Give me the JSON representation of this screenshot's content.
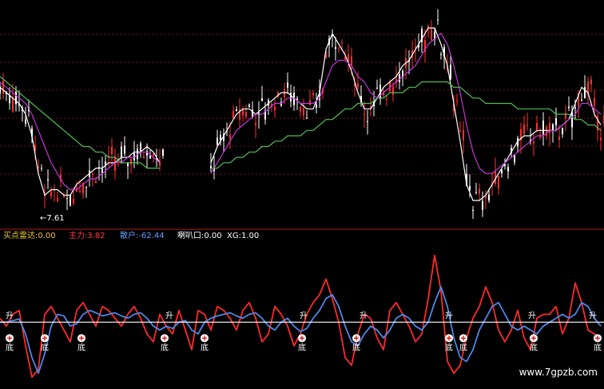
{
  "colors": {
    "background": "#000000",
    "grid": "#7a1414",
    "divider": "#b01818",
    "zero_line": "#ffffff",
    "red_line": "#ff2a2a",
    "blue_line": "#4f86e6",
    "ma_white": "#ffffff",
    "ma_magenta": "#c238d8",
    "ma_green": "#4fbf4f",
    "candle_up": "#ff3030",
    "candle_down": "#ffffff",
    "label_orange": "#e8c33a",
    "label_red": "#ff3c3c",
    "label_blue": "#5fa0ff",
    "label_white": "#ffffff",
    "marker_fill": "#ffffff",
    "marker_cross": "#e01e1e",
    "arrow_yellow": "#f0c040",
    "watermark": "#ffffff"
  },
  "chart_data": [
    {
      "type": "line",
      "panel": "price",
      "low_label": "←7.61",
      "x": [
        0,
        8,
        16,
        24,
        32,
        40,
        48,
        56,
        64,
        72,
        80,
        88,
        96,
        104,
        112,
        120,
        128,
        136,
        144,
        152,
        160,
        168,
        176,
        184,
        192,
        200,
        208,
        216,
        224,
        232,
        240,
        248,
        256,
        264,
        272,
        280,
        288,
        296,
        304,
        312,
        320,
        328,
        336,
        344,
        352,
        360,
        368,
        376,
        384,
        392,
        400,
        408,
        416,
        424,
        432,
        440,
        448,
        456,
        464,
        472,
        480,
        488,
        496,
        504,
        512,
        520,
        528,
        536,
        544,
        552,
        560,
        568,
        576,
        584,
        592,
        600,
        608,
        616,
        624,
        632,
        640,
        648,
        656,
        664,
        672,
        680,
        688,
        696,
        704,
        712,
        720,
        728,
        736,
        744,
        752
      ],
      "series": [
        {
          "color_key": "ma_white",
          "values": [
            9.9,
            9.8,
            9.7,
            9.6,
            9.4,
            9.0,
            8.3,
            7.9,
            8.0,
            8.0,
            7.9,
            7.9,
            8.1,
            8.2,
            8.3,
            8.4,
            8.4,
            8.5,
            8.5,
            8.6,
            8.6,
            8.7,
            8.7,
            8.8,
            8.7,
            8.5,
            null,
            null,
            null,
            null,
            null,
            null,
            null,
            8.5,
            8.8,
            9.0,
            9.2,
            9.4,
            9.5,
            9.5,
            9.4,
            9.5,
            9.6,
            9.7,
            9.8,
            9.8,
            9.7,
            9.6,
            9.5,
            9.5,
            9.8,
            10.6,
            10.9,
            10.7,
            10.5,
            10.2,
            9.8,
            9.5,
            9.5,
            9.7,
            9.9,
            10.0,
            10.1,
            10.3,
            10.4,
            10.6,
            10.8,
            11.0,
            11.0,
            10.7,
            10.3,
            9.6,
            8.9,
            8.1,
            7.8,
            7.8,
            7.9,
            8.1,
            8.3,
            8.5,
            8.7,
            8.9,
            9.0,
            9.0,
            9.1,
            9.1,
            9.1,
            9.1,
            9.2,
            9.3,
            9.6,
            9.9,
            9.8,
            9.4,
            9.2
          ]
        },
        {
          "color_key": "ma_magenta",
          "values": [
            10.0,
            9.9,
            9.8,
            9.7,
            9.6,
            9.4,
            9.1,
            8.8,
            8.5,
            8.3,
            8.1,
            8.0,
            8.0,
            8.1,
            8.2,
            8.2,
            8.3,
            8.4,
            8.5,
            8.5,
            8.6,
            8.6,
            8.7,
            8.7,
            8.6,
            8.5,
            null,
            null,
            null,
            null,
            null,
            null,
            null,
            8.3,
            8.5,
            8.7,
            8.9,
            9.1,
            9.2,
            9.3,
            9.4,
            9.4,
            9.5,
            9.6,
            9.6,
            9.7,
            9.7,
            9.6,
            9.6,
            9.6,
            9.7,
            10.0,
            10.3,
            10.4,
            10.4,
            10.3,
            10.1,
            10.0,
            9.8,
            9.7,
            9.8,
            9.9,
            10.0,
            10.1,
            10.2,
            10.3,
            10.5,
            10.7,
            10.8,
            10.9,
            10.7,
            10.3,
            9.8,
            9.2,
            8.7,
            8.4,
            8.3,
            8.3,
            8.4,
            8.5,
            8.6,
            8.7,
            8.8,
            8.9,
            9.0,
            9.0,
            9.1,
            9.1,
            9.2,
            9.3,
            9.4,
            9.6,
            9.6,
            9.5,
            9.4
          ]
        },
        {
          "color_key": "ma_green",
          "values": [
            10.1,
            10.0,
            9.9,
            9.8,
            9.7,
            9.6,
            9.5,
            9.4,
            9.3,
            9.2,
            9.1,
            9.0,
            8.9,
            8.8,
            8.8,
            8.7,
            8.7,
            8.6,
            8.6,
            8.5,
            8.5,
            8.5,
            8.5,
            8.4,
            8.4,
            8.4,
            null,
            null,
            null,
            null,
            null,
            null,
            null,
            8.4,
            8.4,
            8.5,
            8.5,
            8.6,
            8.6,
            8.7,
            8.7,
            8.8,
            8.8,
            8.9,
            8.9,
            9.0,
            9.0,
            9.0,
            9.1,
            9.1,
            9.2,
            9.3,
            9.3,
            9.4,
            9.5,
            9.5,
            9.6,
            9.6,
            9.6,
            9.7,
            9.7,
            9.8,
            9.8,
            9.8,
            9.9,
            9.9,
            10.0,
            10.0,
            10.0,
            10.0,
            10.0,
            9.9,
            9.9,
            9.8,
            9.7,
            9.7,
            9.6,
            9.6,
            9.6,
            9.6,
            9.6,
            9.5,
            9.5,
            9.5,
            9.5,
            9.5,
            9.5,
            9.4,
            9.4,
            9.4,
            9.3,
            9.3,
            9.2,
            9.2,
            9.1
          ]
        }
      ],
      "ylim": [
        7.4,
        11.4
      ]
    },
    {
      "type": "line",
      "panel": "indicator",
      "legend": [
        {
          "label": "买点雷达:",
          "value": "0.00",
          "color_key": "label_orange"
        },
        {
          "label": "主力:",
          "value": "3.82",
          "color_key": "label_red"
        },
        {
          "label": "散户:",
          "value": "-62.44",
          "color_key": "label_blue"
        },
        {
          "label": "喇叭口:",
          "value": "0.00",
          "color_key": "label_white"
        },
        {
          "label": "XG:",
          "value": "1.00",
          "color_key": "label_white"
        }
      ],
      "x": [
        0,
        8,
        16,
        24,
        32,
        40,
        48,
        56,
        64,
        72,
        80,
        88,
        96,
        104,
        112,
        120,
        128,
        136,
        144,
        152,
        160,
        168,
        176,
        184,
        192,
        200,
        208,
        216,
        224,
        232,
        240,
        248,
        256,
        264,
        272,
        280,
        288,
        296,
        304,
        312,
        320,
        328,
        336,
        344,
        352,
        360,
        368,
        376,
        384,
        392,
        400,
        408,
        416,
        424,
        432,
        440,
        448,
        456,
        464,
        472,
        480,
        488,
        496,
        504,
        512,
        520,
        528,
        536,
        544,
        552,
        560,
        568,
        576,
        584,
        592,
        600,
        608,
        616,
        624,
        632,
        640,
        648,
        656,
        664,
        672,
        680,
        688,
        696,
        704,
        712,
        720,
        728,
        736,
        744,
        752
      ],
      "series": [
        {
          "color_key": "red_line",
          "values": [
            5,
            -5,
            10,
            15,
            -30,
            -70,
            -60,
            10,
            20,
            5,
            -10,
            -25,
            15,
            25,
            10,
            -5,
            20,
            15,
            5,
            -5,
            10,
            20,
            5,
            -15,
            -25,
            10,
            -5,
            -15,
            15,
            -10,
            -35,
            15,
            10,
            -10,
            20,
            15,
            5,
            -10,
            15,
            25,
            5,
            -25,
            -15,
            20,
            10,
            -5,
            -30,
            -15,
            10,
            25,
            35,
            55,
            30,
            0,
            -45,
            -55,
            -15,
            10,
            5,
            -20,
            -35,
            15,
            25,
            10,
            -5,
            -25,
            -15,
            30,
            85,
            40,
            -50,
            -65,
            -55,
            -20,
            5,
            20,
            45,
            25,
            -10,
            -25,
            -10,
            15,
            -20,
            -35,
            5,
            10,
            10,
            20,
            -15,
            5,
            50,
            25,
            -10,
            -15,
            -20
          ]
        },
        {
          "color_key": "blue_line",
          "values": [
            0,
            0,
            2,
            4,
            -15,
            -45,
            -65,
            -40,
            -5,
            10,
            8,
            -5,
            -2,
            10,
            15,
            12,
            8,
            10,
            12,
            8,
            5,
            10,
            12,
            5,
            -5,
            -10,
            -5,
            -8,
            0,
            2,
            -10,
            -15,
            0,
            5,
            8,
            10,
            12,
            8,
            5,
            10,
            12,
            5,
            -5,
            -10,
            0,
            5,
            -5,
            -12,
            -8,
            5,
            15,
            30,
            35,
            20,
            -5,
            -25,
            -30,
            -15,
            -5,
            -10,
            -20,
            -10,
            5,
            10,
            5,
            -5,
            -10,
            0,
            25,
            45,
            20,
            -20,
            -45,
            -50,
            -35,
            -10,
            5,
            20,
            25,
            10,
            -5,
            -10,
            -5,
            -10,
            -15,
            -5,
            0,
            5,
            10,
            5,
            10,
            25,
            20,
            5,
            -5
          ]
        }
      ],
      "ylim": [
        -80,
        100
      ]
    }
  ],
  "markers": {
    "sheng_label": "升",
    "di_label": "底",
    "sheng_x": [
      12,
      212,
      380,
      455,
      562,
      666,
      742
    ],
    "di_x": [
      12,
      56,
      102,
      206,
      256,
      378,
      446,
      562,
      580,
      668,
      748
    ]
  },
  "watermark": "www.7gpzb.com"
}
